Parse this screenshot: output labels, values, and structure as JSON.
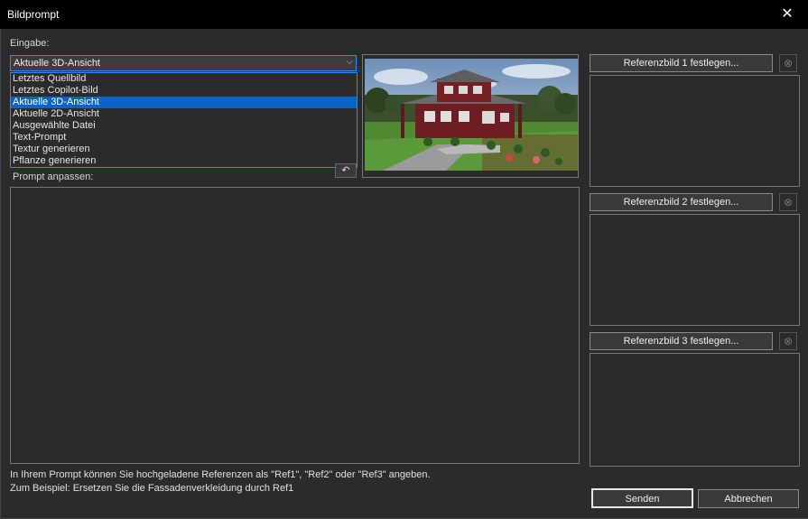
{
  "window": {
    "title": "Bildprompt",
    "close_icon": "close-icon"
  },
  "input": {
    "label": "Eingabe:",
    "selected": "Aktuelle 3D-Ansicht",
    "options": [
      "Letztes Quellbild",
      "Letztes Copilot-Bild",
      "Aktuelle 3D-Ansicht",
      "Aktuelle 2D-Ansicht",
      "Ausgewählte Datei",
      "Text-Prompt",
      "Textur generieren",
      "Pflanze generieren"
    ],
    "selected_index": 2
  },
  "prompt": {
    "label": "Prompt anpassen:",
    "value": ""
  },
  "references": [
    {
      "button": "Referenzbild 1 festlegen..."
    },
    {
      "button": "Referenzbild 2 festlegen..."
    },
    {
      "button": "Referenzbild 3 festlegen..."
    }
  ],
  "hint": {
    "line1": "In Ihrem Prompt können Sie hochgeladene Referenzen als \"Ref1\", \"Ref2\" oder \"Ref3\" angeben.",
    "line2": "Zum Beispiel: Ersetzen Sie die Fassadenverkleidung durch Ref1"
  },
  "buttons": {
    "send": "Senden",
    "cancel": "Abbrechen"
  },
  "colors": {
    "accent": "#1e90ff",
    "selection": "#0a64c8",
    "background": "#2b2b2b"
  }
}
